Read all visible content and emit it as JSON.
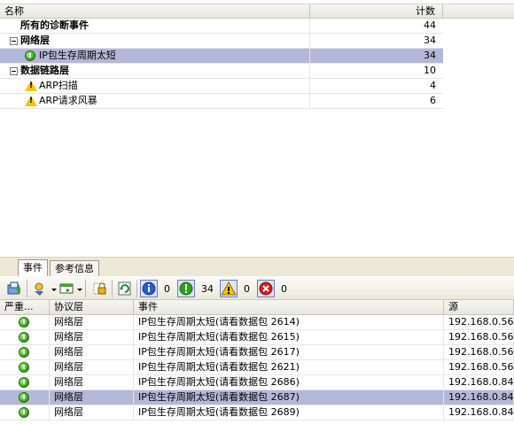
{
  "tree": {
    "columns": {
      "name": "名称",
      "count": "计数"
    },
    "rows": [
      {
        "label": "所有的诊断事件",
        "count": "44",
        "bold": true,
        "indent": 0,
        "expander": false,
        "icon": null,
        "selected": false
      },
      {
        "label": "网络层",
        "count": "34",
        "bold": true,
        "indent": 0,
        "expander": true,
        "icon": null,
        "selected": false
      },
      {
        "label": "IP包生存周期太短",
        "count": "34",
        "bold": false,
        "indent": 1,
        "expander": false,
        "icon": "ok-icon",
        "selected": true
      },
      {
        "label": "数据链路层",
        "count": "10",
        "bold": true,
        "indent": 0,
        "expander": true,
        "icon": null,
        "selected": false
      },
      {
        "label": "ARP扫描",
        "count": "4",
        "bold": false,
        "indent": 1,
        "expander": false,
        "icon": "warn-icon",
        "selected": false
      },
      {
        "label": "ARP请求风暴",
        "count": "6",
        "bold": false,
        "indent": 1,
        "expander": false,
        "icon": "warn-icon",
        "selected": false
      }
    ]
  },
  "tabs": [
    {
      "label": "事件",
      "active": true
    },
    {
      "label": "参考信息",
      "active": false
    }
  ],
  "toolbar": {
    "info_count": "0",
    "ok_count": "34",
    "warn_count": "0",
    "error_count": "0"
  },
  "events": {
    "columns": {
      "severity": "严重...",
      "protocol": "协议层",
      "event": "事件",
      "source": "源"
    },
    "rows": [
      {
        "protocol": "网络层",
        "event": "IP包生存周期太短(请看数据包  2614)",
        "source": "192.168.0.56",
        "selected": false
      },
      {
        "protocol": "网络层",
        "event": "IP包生存周期太短(请看数据包  2615)",
        "source": "192.168.0.56",
        "selected": false
      },
      {
        "protocol": "网络层",
        "event": "IP包生存周期太短(请看数据包  2617)",
        "source": "192.168.0.56",
        "selected": false
      },
      {
        "protocol": "网络层",
        "event": "IP包生存周期太短(请看数据包  2621)",
        "source": "192.168.0.56",
        "selected": false
      },
      {
        "protocol": "网络层",
        "event": "IP包生存周期太短(请看数据包  2686)",
        "source": "192.168.0.84",
        "selected": false
      },
      {
        "protocol": "网络层",
        "event": "IP包生存周期太短(请看数据包  2687)",
        "source": "192.168.0.84",
        "selected": true
      },
      {
        "protocol": "网络层",
        "event": "IP包生存周期太短(请看数据包  2689)",
        "source": "192.168.0.84",
        "selected": false
      }
    ]
  },
  "colors": {
    "selection": "#b4b8d8",
    "ok": "#2da014",
    "warn": "#f5c400",
    "error": "#d42020",
    "info": "#2a5bd0"
  }
}
